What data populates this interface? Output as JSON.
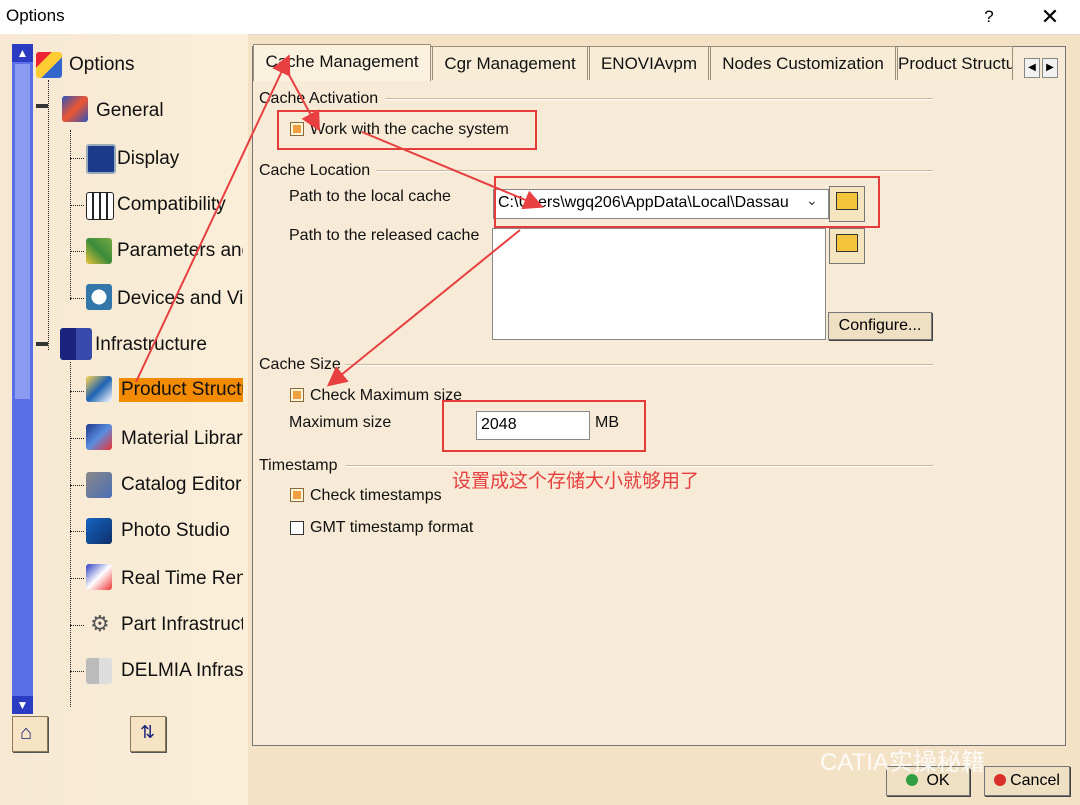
{
  "window": {
    "title": "Options",
    "help": "?",
    "close": "✕"
  },
  "tree": {
    "root": "Options",
    "items": [
      {
        "label": "General"
      },
      {
        "label": "Display"
      },
      {
        "label": "Compatibility"
      },
      {
        "label": "Parameters and Measure"
      },
      {
        "label": "Devices and Virtual Reality"
      },
      {
        "label": "Infrastructure"
      },
      {
        "label": "Product Structure"
      },
      {
        "label": "Material Library"
      },
      {
        "label": "Catalog Editor"
      },
      {
        "label": "Photo Studio"
      },
      {
        "label": "Real Time Rendering"
      },
      {
        "label": "Part Infrastructure"
      },
      {
        "label": "DELMIA Infrastructure"
      }
    ]
  },
  "tabs": [
    "Cache Management",
    "Cgr Management",
    "ENOVIAvpm",
    "Nodes Customization",
    "Product Structure"
  ],
  "cache_activation": {
    "title": "Cache Activation",
    "checkbox": "Work with the cache system",
    "checked": true
  },
  "cache_location": {
    "title": "Cache Location",
    "local_label": "Path to the local cache",
    "local_value": "C:\\Users\\wgq206\\AppData\\Local\\Dassau",
    "released_label": "Path to the released cache",
    "configure": "Configure..."
  },
  "cache_size": {
    "title": "Cache Size",
    "checkbox": "Check Maximum size",
    "checked": true,
    "max_label": "Maximum size",
    "max_value": "2048",
    "unit": "MB"
  },
  "timestamp": {
    "title": "Timestamp",
    "check_timestamps": "Check timestamps",
    "check_timestamps_checked": true,
    "gmt": "GMT timestamp format",
    "gmt_checked": false
  },
  "annotation": "设置成这个存储大小就够用了",
  "watermark": "CATIA实操秘籍",
  "buttons": {
    "ok": "OK",
    "cancel": "Cancel"
  },
  "colors": {
    "annotation": "#e84040",
    "selected": "#f28b00",
    "scrollbar": "#5a6ee8"
  }
}
